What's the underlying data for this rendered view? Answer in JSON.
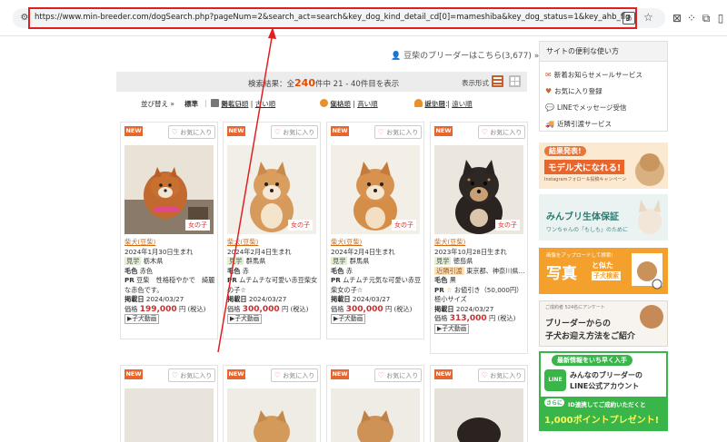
{
  "browser": {
    "url": "https://www.min-breeder.com/dogSearch.php?pageNum=2&search_act=search&key_dog_kind_detail_cd[0]=mameshiba&key_dog_status=1&key_ahb_flg=1",
    "tune_icon": "tune-icon",
    "translate_label": "あ",
    "star_icon": "star-icon",
    "ext_icons": [
      "ad-block-icon",
      "grid-apps-icon",
      "extensions-icon",
      "split-icon",
      "profile-icon",
      "menu-icon"
    ]
  },
  "header": {
    "breeder_link": "豆柴のブリーダーはこちら(3,677) »"
  },
  "results": {
    "prefix": "検索結果：全",
    "count": "240",
    "suffix": "件中 21 - 40件目を表示",
    "view_label": "表示形式"
  },
  "sort": {
    "label": "並び替え »",
    "standard": "標準",
    "posted_label": "掲載日：",
    "posted_new": "新しい順",
    "posted_old": "古い順",
    "price_label": "価格：",
    "price_low": "安い順",
    "price_high": "高い順",
    "birth_label": "誕生日：",
    "birth_near": "近い順",
    "birth_far": "遠い順",
    "sep": "|"
  },
  "card_labels": {
    "new": "NEW",
    "fav": "お気に入り",
    "see_label": "見学",
    "coat_label": "毛色",
    "pr_label": "PR",
    "posted_label": "掲載日",
    "price_label": "価格",
    "yen": "円",
    "tax": "(税込)",
    "video": "子犬動画"
  },
  "dogs": [
    {
      "gender": "女の子",
      "breed": "柴犬(豆柴)",
      "birth": "2024年1月30日生まれ",
      "location": "栃木県",
      "coat": "赤色",
      "pr": "豆柴　性格穏やかで　綺麗な赤色です。",
      "posted": "2024/03/27",
      "price": "199,000"
    },
    {
      "gender": "女の子",
      "breed": "柴犬(豆柴)",
      "birth": "2024年2月4日生まれ",
      "location": "群馬県",
      "coat": "赤",
      "pr": "ムチムチな可愛い赤豆柴女の子☆",
      "posted": "2024/03/27",
      "price": "300,000"
    },
    {
      "gender": "女の子",
      "breed": "柴犬(豆柴)",
      "birth": "2024年2月4日生まれ",
      "location": "群馬県",
      "coat": "赤",
      "pr": "ムチムチ元気な可愛い赤豆柴女の子☆",
      "posted": "2024/03/27",
      "price": "300,000"
    },
    {
      "gender": "女の子",
      "breed": "柴犬(豆柴)",
      "birth": "2023年10月28日生まれ",
      "location": "徳島県",
      "nearby": "近隣引渡",
      "nearby_place": "東京都、神奈川県...",
      "coat": "黒",
      "pr": "お値引き（50,000円）極小サイズ",
      "posted": "2024/03/27",
      "price": "313,000"
    }
  ],
  "sidebar": {
    "head": "サイトの便利な使い方",
    "items": [
      "新着お知らせメールサービス",
      "お気に入り登録",
      "LINEでメッセージ受信",
      "近隣引渡サービス"
    ],
    "banners": [
      {
        "line1": "結果発表!",
        "line2": "モデル犬になれる!",
        "line3": "Instagramフォロー＆投稿キャンペーン"
      },
      {
        "line1": "みんブリ生体保証",
        "line2": "ワンちゃんの「もしも」のために"
      },
      {
        "line1": "画像をアップロードして検索!",
        "line2": "写真",
        "line3": "と似た",
        "line4": "子犬検索"
      },
      {
        "line1": "ご成約者 524名にアンケート",
        "line2": "ブリーダーからの",
        "line3": "子犬お迎え方法をご紹介"
      },
      {
        "line1": "最新情報をいち早く入手",
        "line2": "みんなのブリーダーの",
        "line3": "LINE公式アカウント",
        "line4": "ID連携してご成約いただくと",
        "line5": "1,000ポイントプレゼント!",
        "line6": "さらに",
        "line7": "LINE"
      }
    ]
  }
}
